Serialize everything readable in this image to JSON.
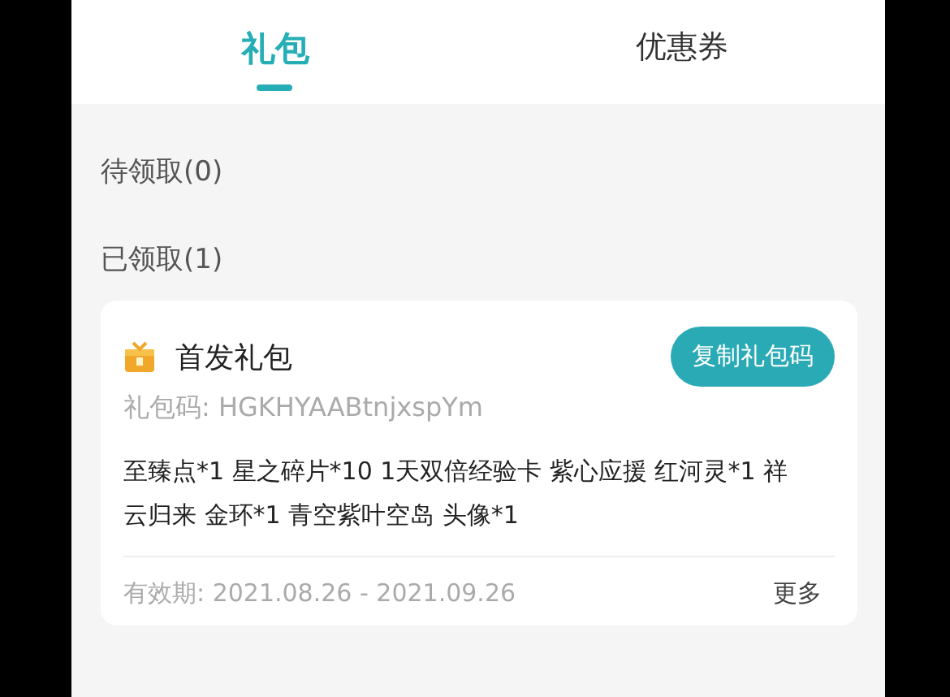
{
  "tabs": [
    {
      "label": "礼包",
      "selected": true
    },
    {
      "label": "优惠券",
      "selected": false
    }
  ],
  "sections": [
    {
      "title": "待领取(0)"
    },
    {
      "title": "已领取(1)",
      "gifts": [
        {
          "name": "首发礼包",
          "button": "复制礼包码",
          "code": "礼包码: HGKHYAABtnjxspYm",
          "contents": "至臻点*1 星之碎片*10 1天双倍经验卡 紫心应援 红河灵*1 祥云归来 金环*1 青空紫叶空岛 头像*1",
          "validity": "有效期: 2021.08.26 - 2021.09.26",
          "more": "更多"
        }
      ]
    }
  ]
}
